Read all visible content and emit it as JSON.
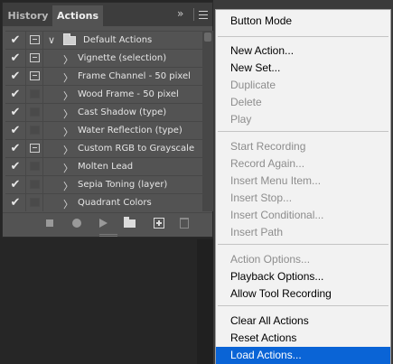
{
  "panel": {
    "tabs": [
      {
        "label": "History",
        "active": false
      },
      {
        "label": "Actions",
        "active": true
      }
    ],
    "collapse_glyph": "»",
    "rows": [
      {
        "label": "Default Actions",
        "checked": true,
        "dialog": true,
        "type": "set",
        "expanded": true
      },
      {
        "label": "Vignette (selection)",
        "checked": true,
        "dialog": true,
        "type": "action"
      },
      {
        "label": "Frame Channel - 50 pixel",
        "checked": true,
        "dialog": true,
        "type": "action"
      },
      {
        "label": "Wood Frame - 50 pixel",
        "checked": true,
        "dialog": false,
        "type": "action"
      },
      {
        "label": "Cast Shadow (type)",
        "checked": true,
        "dialog": false,
        "type": "action"
      },
      {
        "label": "Water Reflection (type)",
        "checked": true,
        "dialog": false,
        "type": "action"
      },
      {
        "label": "Custom RGB to Grayscale",
        "checked": true,
        "dialog": true,
        "type": "action"
      },
      {
        "label": "Molten Lead",
        "checked": true,
        "dialog": false,
        "type": "action"
      },
      {
        "label": "Sepia Toning (layer)",
        "checked": true,
        "dialog": false,
        "type": "action"
      },
      {
        "label": "Quadrant Colors",
        "checked": true,
        "dialog": false,
        "type": "action"
      }
    ],
    "footer_icons": [
      "stop-icon",
      "record-icon",
      "play-icon",
      "new-set-icon",
      "new-action-icon",
      "trash-icon"
    ]
  },
  "menu": {
    "groups": [
      [
        {
          "label": "Button Mode",
          "enabled": true
        }
      ],
      [
        {
          "label": "New Action...",
          "enabled": true
        },
        {
          "label": "New Set...",
          "enabled": true
        },
        {
          "label": "Duplicate",
          "enabled": false
        },
        {
          "label": "Delete",
          "enabled": false
        },
        {
          "label": "Play",
          "enabled": false
        }
      ],
      [
        {
          "label": "Start Recording",
          "enabled": false
        },
        {
          "label": "Record Again...",
          "enabled": false
        },
        {
          "label": "Insert Menu Item...",
          "enabled": false
        },
        {
          "label": "Insert Stop...",
          "enabled": false
        },
        {
          "label": "Insert Conditional...",
          "enabled": false
        },
        {
          "label": "Insert Path",
          "enabled": false
        }
      ],
      [
        {
          "label": "Action Options...",
          "enabled": false
        },
        {
          "label": "Playback Options...",
          "enabled": true
        },
        {
          "label": "Allow Tool Recording",
          "enabled": true
        }
      ],
      [
        {
          "label": "Clear All Actions",
          "enabled": true
        },
        {
          "label": "Reset Actions",
          "enabled": true
        },
        {
          "label": "Load Actions...",
          "enabled": true,
          "highlighted": true
        }
      ]
    ]
  },
  "colors": {
    "panel_bg": "#535353",
    "menu_bg": "#f2f2f2",
    "highlight": "#0a64d6",
    "disabled_text": "#8d8d8d"
  }
}
